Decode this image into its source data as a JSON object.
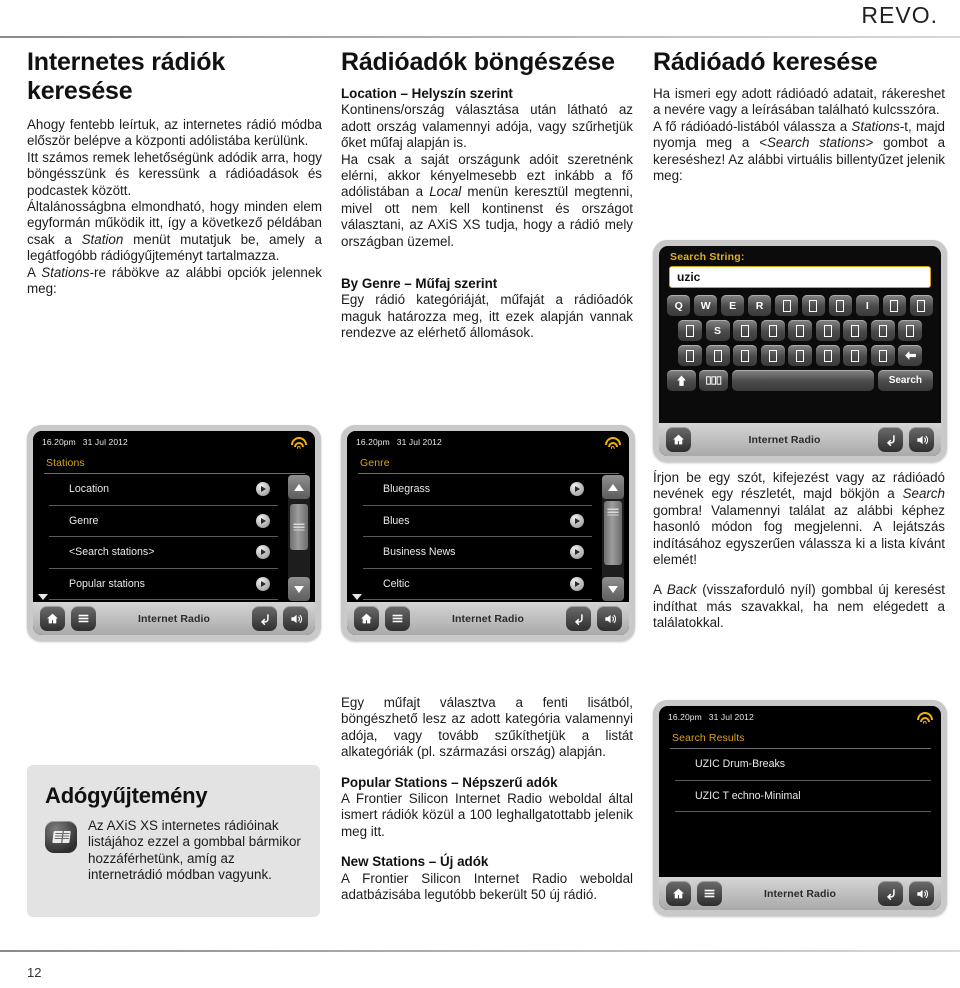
{
  "header": {
    "brand": "REVO."
  },
  "footer": {
    "page_number": "12"
  },
  "col1": {
    "title": "Internetes rádiók keresése",
    "p1": "Ahogy fentebb leírtuk, az internetes rádió módba először belépve a központi adólistába kerülünk.",
    "p2": "Itt számos remek lehetőségünk adódik arra, hogy böngésszünk és keressünk a rádióadások és podcastek között.",
    "p3_a": "Általánosságbna elmondható, hogy minden elem egyformán működik itt, így a következő példában csak a ",
    "p3_i": "Station",
    "p3_b": " menüt mutatjuk be, amely a legátfogóbb rádiógyűjteményt tartalmazza.",
    "p4_a": "A ",
    "p4_i": "Stations",
    "p4_b": "-re rábökve az alábbi opciók jelennek meg:"
  },
  "col2": {
    "title": "Rádióadók böngészése",
    "sub1": "Location – Helyszín szerint",
    "p1": "Kontinens/ország választása után látható az adott ország valamennyi adója, vagy szűrhetjük őket műfaj alapján is.",
    "p2_a": "Ha csak a saját országunk adóit szeretnénk elérni, akkor kényelmesebb ezt inkább a fő adólistában a ",
    "p2_i": "Local",
    "p2_b": " menün keresztül megtenni, mivel ott nem kell kontinenst és országot választani, az AXiS XS tudja, hogy a rádió mely országban üzemel.",
    "sub2": "By Genre – Műfaj szerint",
    "p3": "Egy rádió kategóriáját, műfaját a rádióadók maguk határozza meg, itt ezek alapján vannak rendezve az elérhető állomások."
  },
  "col2_bottom": {
    "p1": "Egy műfajt választva a fenti lisátból, böngészhető lesz az adott kategória valamennyi adója, vagy tovább szűkíthetjük a listát alkategóriák (pl. származási ország) alapján.",
    "sub1": "Popular Stations – Népszerű adók",
    "p2": "A Frontier Silicon Internet Radio weboldal által ismert rádiók közül a 100 leghallgatottabb jelenik meg itt.",
    "sub2": "New Stations – Új adók",
    "p3": "A Frontier Silicon Internet Radio weboldal adatbázisába legutóbb bekerült 50 új rádió."
  },
  "col3": {
    "title": "Rádióadó keresése",
    "p1": "Ha ismeri egy adott rádióadó adatait, rákereshet a nevére vagy a leírásában található kulcsszóra.",
    "p2_a": "A fő rádióadó-listából válassza a ",
    "p2_i1": "Stations",
    "p2_b": "-t, majd nyomja meg a ",
    "p2_i2": "<Search stations>",
    "p2_c": " gombot a kereséshez! Az alábbi virtuális billentyűzet jelenik meg:"
  },
  "col3_bottom": {
    "p1_a": "Írjon be egy szót, kifejezést vagy az rádióadó nevének egy részletét, majd bökjön a ",
    "p1_i": "Search",
    "p1_b": " gombra! Valamennyi találat az alábbi képhez hasonló módon fog megjelenni. A lejátszás indításához egyszerűen válassza ki a lista kívánt elemét!",
    "p2_a": "A ",
    "p2_i": "Back",
    "p2_b": " (visszaforduló nyíl) gombbal új keresést indíthat más szavakkal, ha nem elégedett a találatokkal."
  },
  "callout": {
    "title": "Adógyűjtemény",
    "text": "Az AXiS XS internetes rádióinak listájához ezzel a gombbal bármikor hozzáférhetünk, amíg az internetrádió módban vagyunk.",
    "icon": "book-list-icon"
  },
  "devices": {
    "status": {
      "time": "16.20pm",
      "date": "31 Jul 2012",
      "wifi_icon": "wifi-icon",
      "accent": "#d8a318"
    },
    "bottombar": {
      "title": "Internet Radio",
      "home_icon": "home-icon",
      "menu_icon": "menu-icon",
      "back_icon": "back-arrow-icon",
      "volume_icon": "volume-icon"
    },
    "stations": {
      "screen_title": "Stations",
      "items": [
        {
          "label": "Location"
        },
        {
          "label": "Genre"
        },
        {
          "label": "<Search stations>"
        },
        {
          "label": "Popular stations"
        }
      ],
      "scroll_thumb_top_pct": 4,
      "scroll_thumb_height_pct": 62
    },
    "genre": {
      "screen_title": "Genre",
      "items": [
        {
          "label": "Bluegrass"
        },
        {
          "label": "Blues"
        },
        {
          "label": "Business News"
        },
        {
          "label": "Celtic"
        }
      ],
      "scroll_thumb_top_pct": 0,
      "scroll_thumb_height_pct": 86
    },
    "results": {
      "screen_title": "Search Results",
      "items": [
        {
          "label": "UZIC Drum-Breaks"
        },
        {
          "label": "UZIC T  echno-Minimal"
        }
      ]
    },
    "keyboard": {
      "field_label": "Search String:",
      "field_value": "uzic",
      "row1": [
        "Q",
        "W",
        "E",
        "R",
        "",
        "",
        "",
        "I",
        "",
        ""
      ],
      "row2": [
        "",
        "S",
        "",
        "",
        "",
        "",
        "",
        "",
        ""
      ],
      "row3": [
        "",
        "",
        "",
        "",
        "",
        "",
        "",
        ""
      ],
      "backspace_icon": "backspace-arrow-icon",
      "shift_icon": "shift-up-arrow-icon",
      "symbols_icon": "symbols-icon",
      "space_label": "",
      "search_label": "Search"
    }
  }
}
